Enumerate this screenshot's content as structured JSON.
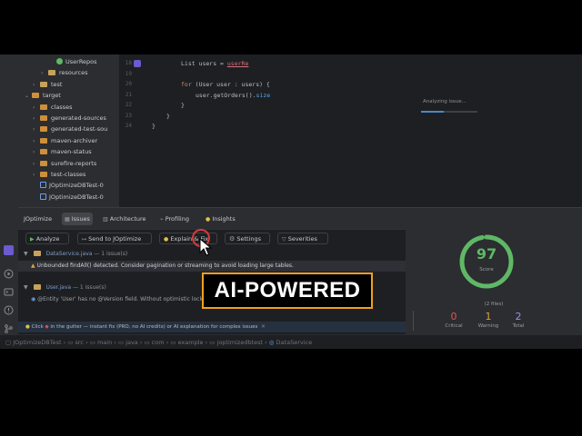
{
  "project_tree": {
    "items": [
      {
        "label": "UserRepos",
        "type": "class-green",
        "indent": 4
      },
      {
        "label": "resources",
        "type": "folder",
        "indent": 3,
        "chevron": "›"
      },
      {
        "label": "test",
        "type": "folder",
        "indent": 2,
        "chevron": "›"
      },
      {
        "label": "target",
        "type": "folder-orange",
        "indent": 1,
        "chevron": "⌄"
      },
      {
        "label": "classes",
        "type": "folder-orange",
        "indent": 2,
        "chevron": "›"
      },
      {
        "label": "generated-sources",
        "type": "folder-orange",
        "indent": 2,
        "chevron": "›"
      },
      {
        "label": "generated-test-sou",
        "type": "folder-orange",
        "indent": 2,
        "chevron": "›"
      },
      {
        "label": "maven-archiver",
        "type": "folder-orange",
        "indent": 2,
        "chevron": "›"
      },
      {
        "label": "maven-status",
        "type": "folder-orange",
        "indent": 2,
        "chevron": "›"
      },
      {
        "label": "surefire-reports",
        "type": "folder-orange",
        "indent": 2,
        "chevron": "›"
      },
      {
        "label": "test-classes",
        "type": "folder-orange",
        "indent": 2,
        "chevron": "›"
      },
      {
        "label": "JOptimizeDBTest-0",
        "type": "file",
        "indent": 2
      },
      {
        "label": "JOptimizeDBTest-0",
        "type": "file",
        "indent": 2
      }
    ]
  },
  "editor": {
    "lines": [
      {
        "num": "18",
        "code": "List<User> users = userRe"
      },
      {
        "num": "19",
        "code": ""
      },
      {
        "num": "20",
        "code": "for (User user : users) {"
      },
      {
        "num": "21",
        "code": "user.getOrders().size"
      },
      {
        "num": "22",
        "code": "}"
      },
      {
        "num": "23",
        "code": "}"
      },
      {
        "num": "24",
        "code": "}"
      }
    ]
  },
  "analyzing": {
    "text": "Analyzing issue...",
    "progress": 0.4
  },
  "tool_window": {
    "title": "JOptimize",
    "tabs": [
      {
        "label": "Issues",
        "active": true
      },
      {
        "label": "Architecture"
      },
      {
        "label": "Profiling"
      },
      {
        "label": "Insights"
      }
    ]
  },
  "toolbar": {
    "analyze": "Analyze",
    "send": "Send to JOptimize",
    "explain_fix": "Explain & Fix",
    "settings": "Settings",
    "severities": "Severities"
  },
  "issues": {
    "file1": "DataService.java",
    "file1_count": "— 1 issue(s)",
    "file1_issue": "Unbounded findAll() detected. Consider pagination or streaming to avoid loading large tables.",
    "file2": "User.java",
    "file2_count": "— 1 issue(s)",
    "file2_issue": "@Entity 'User' has no @Version field. Without optimistic locking, concurrent updates silently overwrite eac"
  },
  "hint": {
    "prefix": "Click",
    "text": "in the gutter — instant fix (PRO, no AI credits) or AI explanation for complex issues",
    "close": "✕"
  },
  "score": {
    "value": "97",
    "label": "Score",
    "files": "(2 files)",
    "critical": "0",
    "critical_label": "Critical",
    "warning": "1",
    "warning_label": "Warning",
    "total": "2",
    "total_label": "Total",
    "ring_fraction": 0.97,
    "ring_color": "#5fb865",
    "critical_color": "#e05555",
    "warning_color": "#e0a040",
    "total_color": "#9b8fe0"
  },
  "breadcrumb": {
    "items": [
      "JOptimizeDBTest",
      "src",
      "main",
      "java",
      "com",
      "example",
      "joptimizedbtest",
      "DataService"
    ]
  },
  "overlay": {
    "label": "AI-POWERED",
    "border_color": "#f0a020"
  }
}
